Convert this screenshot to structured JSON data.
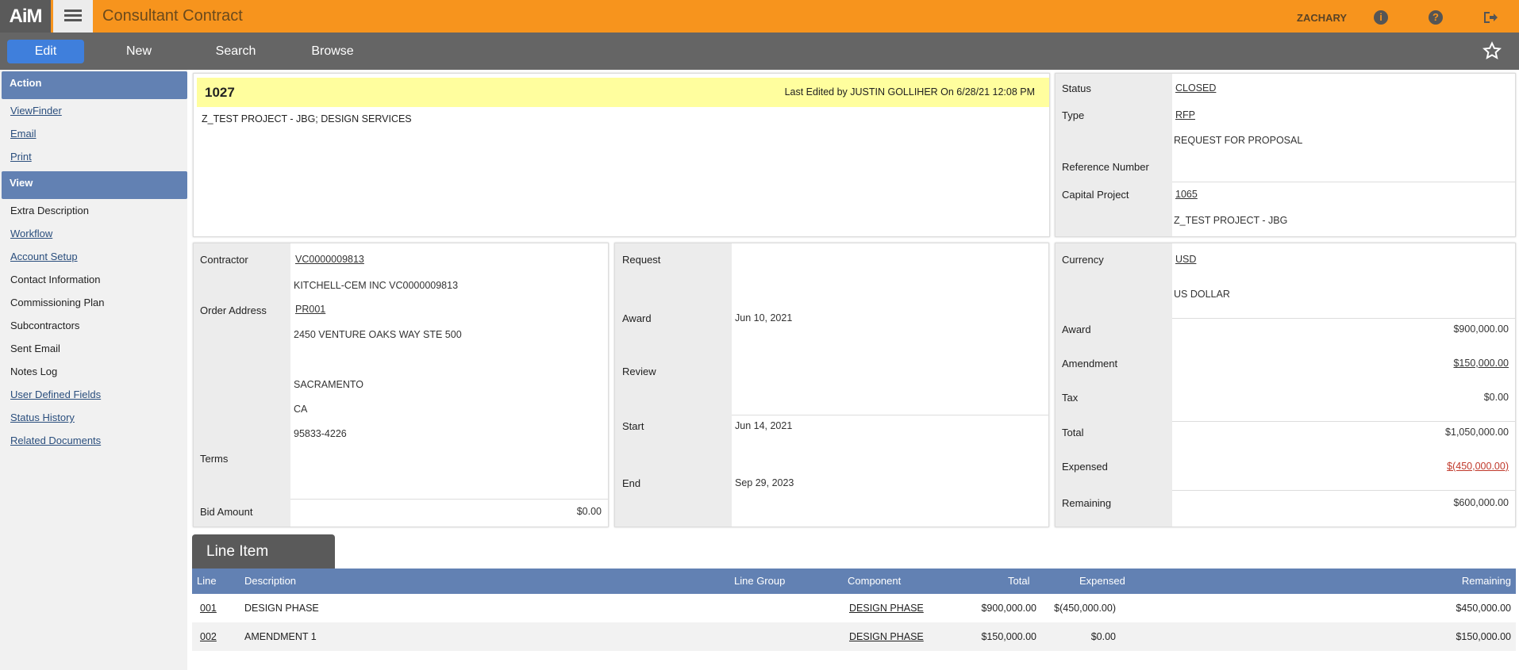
{
  "header": {
    "logo": "AiM",
    "title": "Consultant Contract",
    "user": "ZACHARY"
  },
  "commands": {
    "edit": "Edit",
    "new": "New",
    "search": "Search",
    "browse": "Browse"
  },
  "sidebar": {
    "action_heading": "Action",
    "actions": [
      "ViewFinder",
      "Email",
      "Print"
    ],
    "view_heading": "View",
    "views": [
      {
        "label": "Extra Description",
        "link": false
      },
      {
        "label": "Workflow",
        "link": true
      },
      {
        "label": "Account Setup",
        "link": true
      },
      {
        "label": "Contact Information",
        "link": false
      },
      {
        "label": "Commissioning Plan",
        "link": false
      },
      {
        "label": "Subcontractors",
        "link": false
      },
      {
        "label": "Sent Email",
        "link": false
      },
      {
        "label": "Notes Log",
        "link": false
      },
      {
        "label": "User Defined Fields",
        "link": true
      },
      {
        "label": "Status History",
        "link": true
      },
      {
        "label": "Related Documents",
        "link": true
      }
    ]
  },
  "record": {
    "number": "1027",
    "last_edited": "Last Edited by JUSTIN GOLLIHER On 6/28/21 12:08 PM",
    "description": "Z_TEST PROJECT - JBG; DESIGN SERVICES"
  },
  "status_panel": {
    "status_label": "Status",
    "status_value": "CLOSED",
    "type_label": "Type",
    "type_value": "RFP",
    "type_desc": "REQUEST FOR PROPOSAL",
    "ref_label": "Reference Number",
    "capital_label": "Capital Project",
    "capital_value": "1065",
    "capital_desc": "Z_TEST PROJECT - JBG"
  },
  "contractor_panel": {
    "contractor_label": "Contractor",
    "contractor_value": "VC0000009813",
    "contractor_desc": "KITCHELL-CEM INC VC0000009813",
    "order_label": "Order Address",
    "order_value": "PR001",
    "address_line1": "2450 VENTURE OAKS WAY STE 500",
    "city": "SACRAMENTO",
    "state": "CA",
    "zip": "95833-4226",
    "terms_label": "Terms",
    "bid_label": "Bid Amount",
    "bid_value": "$0.00"
  },
  "dates_panel": {
    "request_label": "Request",
    "award_label": "Award",
    "award_value": "Jun 10, 2021",
    "review_label": "Review",
    "start_label": "Start",
    "start_value": "Jun 14, 2021",
    "end_label": "End",
    "end_value": "Sep 29, 2023"
  },
  "finance_panel": {
    "currency_label": "Currency",
    "currency_value": "USD",
    "currency_desc": "US DOLLAR",
    "award_label": "Award",
    "award_value": "$900,000.00",
    "amendment_label": "Amendment",
    "amendment_value": "$150,000.00",
    "tax_label": "Tax",
    "tax_value": "$0.00",
    "total_label": "Total",
    "total_value": "$1,050,000.00",
    "expensed_label": "Expensed",
    "expensed_value": "$(450,000.00)",
    "remaining_label": "Remaining",
    "remaining_value": "$600,000.00"
  },
  "line_items": {
    "tab_label": "Line Item",
    "columns": {
      "line": "Line",
      "description": "Description",
      "line_group": "Line Group",
      "component": "Component",
      "total": "Total",
      "expensed": "Expensed",
      "remaining": "Remaining"
    },
    "rows": [
      {
        "line": "001",
        "description": "DESIGN PHASE",
        "line_group": "",
        "component": "DESIGN PHASE",
        "total": "$900,000.00",
        "expensed": "$(450,000.00)",
        "remaining": "$450,000.00"
      },
      {
        "line": "002",
        "description": "AMENDMENT 1",
        "line_group": "",
        "component": "DESIGN PHASE",
        "total": "$150,000.00",
        "expensed": "$0.00",
        "remaining": "$150,000.00"
      }
    ]
  },
  "colors": {
    "topbar": "#f7941d",
    "command_bar": "#656565",
    "active_button": "#3f7fdc",
    "section_header": "#6281b3",
    "highlight": "#fffe9e",
    "negative": "#c0392b"
  },
  "icons": [
    "menu-icon",
    "info-icon",
    "help-icon",
    "logout-icon",
    "star-icon"
  ]
}
